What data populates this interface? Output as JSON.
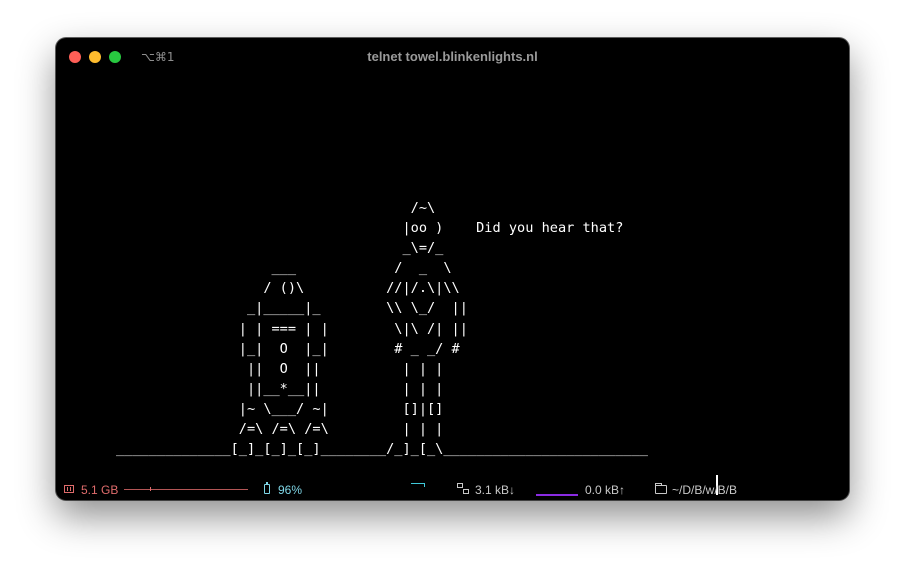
{
  "window": {
    "title": "telnet towel.blinkenlights.nl",
    "shortcut": "⌥⌘1"
  },
  "terminal": {
    "ascii": "                                    /~\\\n                                   |oo )    Did you hear that?\n                                   _\\=/_\n                   ___            /  _  \\\n                  / ()\\          //|/.\\|\\\\\n                _|_____|_        \\\\ \\_/  ||\n               | | === | |        \\|\\ /| ||\n               |_|  O  |_|        # _ _/ #\n                ||  O  ||          | | |\n                ||__*__||          | | |\n               |~ \\___/ ~|         []|[]\n               /=\\ /=\\ /=\\         | | |\n______________[_]_[_]_[_]________/_]_[_\\_________________________"
  },
  "statusbar": {
    "memory": "5.1 GB",
    "battery": "96%",
    "download": "3.1 kB↓",
    "upload": "0.0 kB↑",
    "path": "~/D/B/w/B/B"
  },
  "colors": {
    "memory": "#e06c6c",
    "battery": "#7fd6e6",
    "network": "#c8c8c8",
    "upload_graph": "#8a2be2",
    "cpu_graph": "#3fc8d8"
  }
}
